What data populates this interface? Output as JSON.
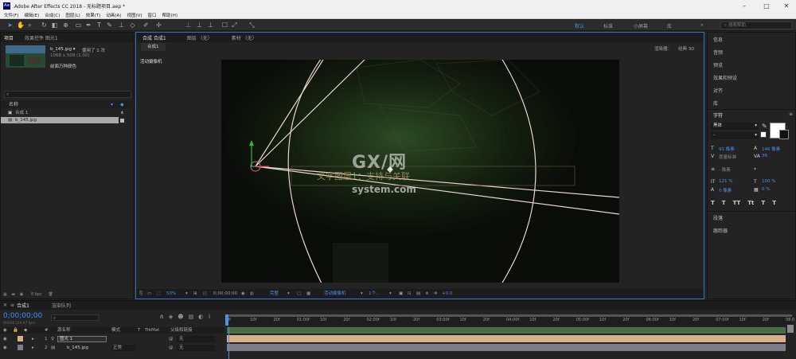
{
  "window": {
    "app_icon": "Ae",
    "title": "Adobe After Effects CC 2018 - 无标题项目.aep *",
    "controls": [
      "minimize-icon",
      "maximize-icon",
      "close-icon"
    ]
  },
  "menu": [
    "文件(F)",
    "编辑(E)",
    "合成(C)",
    "图层(L)",
    "效果(T)",
    "动画(A)",
    "视图(V)",
    "窗口",
    "帮助(H)"
  ],
  "toolbar": {
    "workspaces": [
      "默认",
      "标准",
      "小屏幕",
      "库"
    ],
    "active_workspace": "默认",
    "search_placeholder": "搜索帮助",
    "more_icon": "»"
  },
  "project_panel": {
    "tabs": [
      "项目",
      "效果控件 图光1"
    ],
    "file_name": "b_145.jpg ▾",
    "file_usage": "使用了 1 次",
    "file_dims": "1068 x 509 (1.00)",
    "overlay_text": "前面万种颜色",
    "column_header": "名称",
    "rows": [
      {
        "name": "合成 1",
        "selected": false
      },
      {
        "name": "b_145.jpg",
        "selected": true
      }
    ],
    "bpc": "8 bpc"
  },
  "composition": {
    "tabs": [
      "合成 合成1",
      "图层 （无）",
      "素材 （无）"
    ],
    "sub_tab": "合成1",
    "renderer_label": "渲染器：",
    "renderer_value": "经典 3D",
    "view_label": "活动摄像机",
    "text_layer": "文字图层1：支持与关联",
    "bottom": {
      "zoom": "50%",
      "timecode": "0;00;00;00",
      "resolution": "完整",
      "camera": "活动摄像机",
      "views": "1个...",
      "exposure": "+0.0"
    }
  },
  "right_panel": {
    "items_top": [
      "信息",
      "音频",
      "预览",
      "效果和预设",
      "对齐",
      "库",
      "字符"
    ],
    "character": {
      "font": "黑体",
      "font_style": "-",
      "size": "91 像素",
      "leading": "146 像素",
      "kerning": "度量标准",
      "tracking": "36",
      "stroke": "- 像素",
      "v_scale": "121 %",
      "h_scale": "100 %",
      "baseline": "0 像素",
      "tsume": "0 %",
      "styles": [
        "T",
        "T",
        "TT",
        "Tt",
        "T",
        "T"
      ]
    },
    "items_bottom": [
      "段落",
      "跟踪器"
    ]
  },
  "timeline": {
    "tabs": [
      "合成1",
      "渲染队列"
    ],
    "timecode": "0;00;00;00",
    "fps_label": "00000 (29.97 fps)",
    "headers": {
      "num": "#",
      "name": "源名称",
      "mode": "模式",
      "t": "T",
      "trkmat": "TrkMat",
      "parent": "父级和链接"
    },
    "layers": [
      {
        "num": "1",
        "name": "图光 1",
        "mode": "",
        "parent": "无"
      },
      {
        "num": "2",
        "name": "b_145.jpg",
        "mode": "正常",
        "parent": "无"
      }
    ],
    "ruler_ticks": [
      "0f",
      "10f",
      "20f",
      "01:00f",
      "10f",
      "20f",
      "02:00f",
      "10f",
      "20f",
      "03:00f",
      "10f",
      "20f",
      "04:00f",
      "10f",
      "20f",
      "05:00f",
      "10f",
      "20f",
      "06:00f",
      "10f",
      "20f",
      "07:00f",
      "10f",
      "20f",
      "08:0"
    ]
  },
  "watermark": {
    "brand": "GX/网",
    "domain": "system.com"
  },
  "colors": {
    "accent": "#3e8bff",
    "layer1_bar": "#d6b08a",
    "layer2_bar": "#7c7c8a",
    "track_green": "#4a6b4a"
  }
}
